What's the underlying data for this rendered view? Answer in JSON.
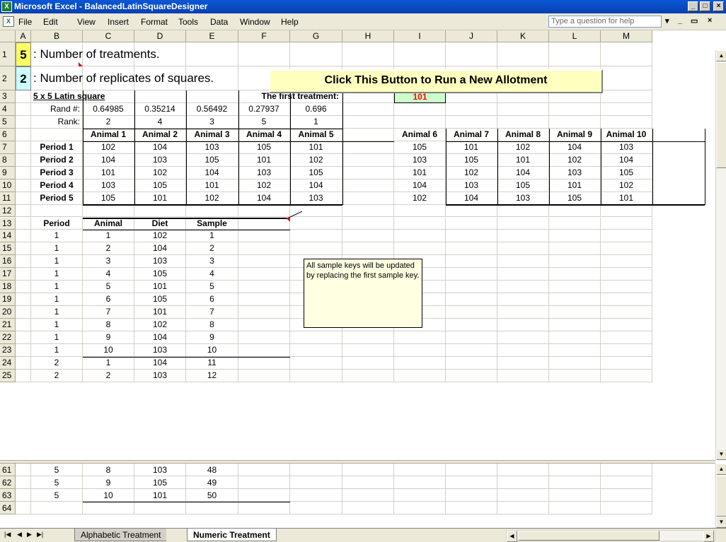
{
  "window": {
    "title": "Microsoft Excel - BalancedLatinSquareDesigner",
    "min": "_",
    "max": "□",
    "close": "×"
  },
  "menu": {
    "items": [
      "File",
      "Edit",
      "View",
      "Insert",
      "Format",
      "Tools",
      "Data",
      "Window",
      "Help"
    ],
    "help_placeholder": "Type a question for help"
  },
  "columns": [
    "A",
    "B",
    "C",
    "D",
    "E",
    "F",
    "G",
    "H",
    "I",
    "J",
    "K",
    "L",
    "M"
  ],
  "top_rows": [
    "1",
    "2",
    "3",
    "4",
    "5",
    "6",
    "7",
    "8",
    "9",
    "10",
    "11",
    "12",
    "13",
    "14",
    "15",
    "16",
    "17",
    "18",
    "19",
    "20",
    "21",
    "22",
    "23",
    "24",
    "25"
  ],
  "bottom_rows": [
    "61",
    "62",
    "63",
    "64"
  ],
  "params": {
    "treatments_value": "5",
    "treatments_label": ": Number of treatments.",
    "replicates_value": "2",
    "replicates_label": ": Number of replicates of squares.",
    "run_button": "Click This Button to Run a New Allotment"
  },
  "latin": {
    "title": "5 x 5 Latin square",
    "first_treatment_label": "The first treatment:",
    "first_treatment_value": "101",
    "rand_label": "Rand #:",
    "rand_values": [
      "0.64985",
      "0.35214",
      "0.56492",
      "0.27937",
      "0.696"
    ],
    "rank_label": "Rank:",
    "rank_values": [
      "2",
      "4",
      "3",
      "5",
      "1"
    ],
    "animals_left": [
      "Animal 1",
      "Animal 2",
      "Animal 3",
      "Animal 4",
      "Animal 5"
    ],
    "animals_right": [
      "Animal 6",
      "Animal 7",
      "Animal 8",
      "Animal 9",
      "Animal 10"
    ],
    "periods": [
      {
        "label": "Period 1",
        "left": [
          "102",
          "104",
          "103",
          "105",
          "101"
        ],
        "right": [
          "105",
          "101",
          "102",
          "104",
          "103"
        ]
      },
      {
        "label": "Period 2",
        "left": [
          "104",
          "103",
          "105",
          "101",
          "102"
        ],
        "right": [
          "103",
          "105",
          "101",
          "102",
          "104"
        ]
      },
      {
        "label": "Period 3",
        "left": [
          "101",
          "102",
          "104",
          "103",
          "105"
        ],
        "right": [
          "101",
          "102",
          "104",
          "103",
          "105"
        ]
      },
      {
        "label": "Period 4",
        "left": [
          "103",
          "105",
          "101",
          "102",
          "104"
        ],
        "right": [
          "104",
          "103",
          "105",
          "101",
          "102"
        ]
      },
      {
        "label": "Period 5",
        "left": [
          "105",
          "101",
          "102",
          "104",
          "103"
        ],
        "right": [
          "102",
          "104",
          "103",
          "105",
          "101"
        ]
      }
    ]
  },
  "samples": {
    "headers": [
      "Period",
      "Animal",
      "Diet",
      "Sample"
    ],
    "rows_top": [
      [
        "1",
        "1",
        "102",
        "1"
      ],
      [
        "1",
        "2",
        "104",
        "2"
      ],
      [
        "1",
        "3",
        "103",
        "3"
      ],
      [
        "1",
        "4",
        "105",
        "4"
      ],
      [
        "1",
        "5",
        "101",
        "5"
      ],
      [
        "1",
        "6",
        "105",
        "6"
      ],
      [
        "1",
        "7",
        "101",
        "7"
      ],
      [
        "1",
        "8",
        "102",
        "8"
      ],
      [
        "1",
        "9",
        "104",
        "9"
      ],
      [
        "1",
        "10",
        "103",
        "10"
      ],
      [
        "2",
        "1",
        "104",
        "11"
      ],
      [
        "2",
        "2",
        "103",
        "12"
      ]
    ],
    "rows_bottom": [
      [
        "5",
        "8",
        "103",
        "48"
      ],
      [
        "5",
        "9",
        "105",
        "49"
      ],
      [
        "5",
        "10",
        "101",
        "50"
      ]
    ],
    "comment": "All sample keys will be updated by replacing the first sample key."
  },
  "tabs": {
    "sheets": [
      "Alphabetic Treatment",
      "Numeric Treatment"
    ],
    "active": "Numeric Treatment"
  },
  "colors": {
    "treatments_fill": "#ffff66",
    "replicates_fill": "#ccffff",
    "first_treatment_fill": "#ccffcc",
    "first_treatment_text": "#ff0000"
  }
}
